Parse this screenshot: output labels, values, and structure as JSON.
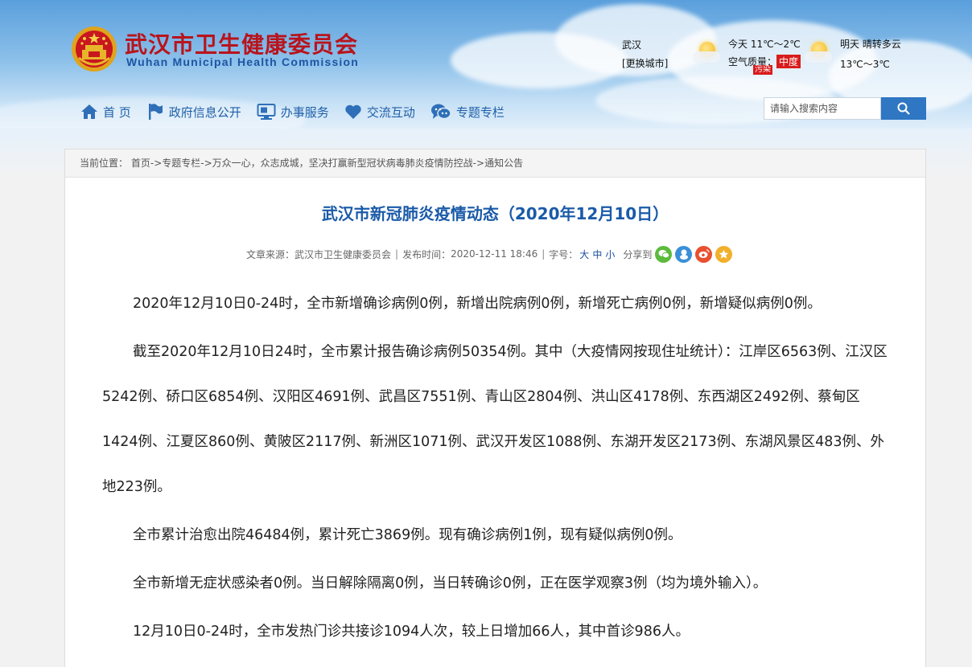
{
  "site": {
    "title": "武汉市卫生健康委员会",
    "subtitle": "Wuhan Municipal Health Commission"
  },
  "weather": {
    "city": "武汉",
    "change_city": "[更换城市]",
    "today": "今天 11℃～2℃",
    "air_label": "空气质量：",
    "air_value": "中度",
    "air_warn": "污染",
    "tomorrow": "明天 晴转多云",
    "tomorrow_temp": "13℃～3℃"
  },
  "nav": {
    "items": [
      {
        "label": "首 页",
        "icon": "home-icon"
      },
      {
        "label": "政府信息公开",
        "icon": "flag-icon"
      },
      {
        "label": "办事服务",
        "icon": "monitor-icon"
      },
      {
        "label": "交流互动",
        "icon": "heart-icon"
      },
      {
        "label": "专题专栏",
        "icon": "chat-icon"
      }
    ]
  },
  "search": {
    "placeholder": "请输入搜索内容",
    "button_icon": "search-icon"
  },
  "breadcrumb": {
    "label": "当前位置：",
    "items": [
      "首页",
      "专题专栏",
      "万众一心，众志成城，坚决打赢新型冠状病毒肺炎疫情防控战",
      "通知公告"
    ],
    "separator": "->"
  },
  "article": {
    "title": "武汉市新冠肺炎疫情动态（2020年12月10日）",
    "meta": {
      "source_label": "文章来源：",
      "source": "武汉市卫生健康委员会",
      "time_label": "发布时间：",
      "time": "2020-12-11 18:46",
      "font_label": "字号：",
      "font_large": "大",
      "font_medium": "中",
      "font_small": "小",
      "share_label": "分享到",
      "share_icons": [
        "wechat-icon",
        "qzone-icon",
        "weibo-icon",
        "favorite-icon"
      ]
    },
    "paragraphs": [
      "2020年12月10日0-24时，全市新增确诊病例0例，新增出院病例0例，新增死亡病例0例，新增疑似病例0例。",
      "截至2020年12月10日24时，全市累计报告确诊病例50354例。其中（大疫情网按现住址统计）：江岸区6563例、江汉区5242例、硚口区6854例、汉阳区4691例、武昌区7551例、青山区2804例、洪山区4178例、东西湖区2492例、蔡甸区1424例、江夏区860例、黄陂区2117例、新洲区1071例、武汉开发区1088例、东湖开发区2173例、东湖风景区483例、外地223例。",
      "全市累计治愈出院46484例，累计死亡3869例。现有确诊病例1例，现有疑似病例0例。",
      "全市新增无症状感染者0例。当日解除隔离0例，当日转确诊0例，正在医学观察3例（均为境外输入）。",
      "12月10日0-24时，全市发热门诊共接诊1094人次，较上日增加66人，其中首诊986人。"
    ]
  },
  "colors": {
    "title_red": "#b8141c",
    "nav_blue": "#1f5fa8",
    "article_title_blue": "#1a5aa8",
    "search_button": "#2f76c3",
    "air_badge": "#d91c1c"
  }
}
